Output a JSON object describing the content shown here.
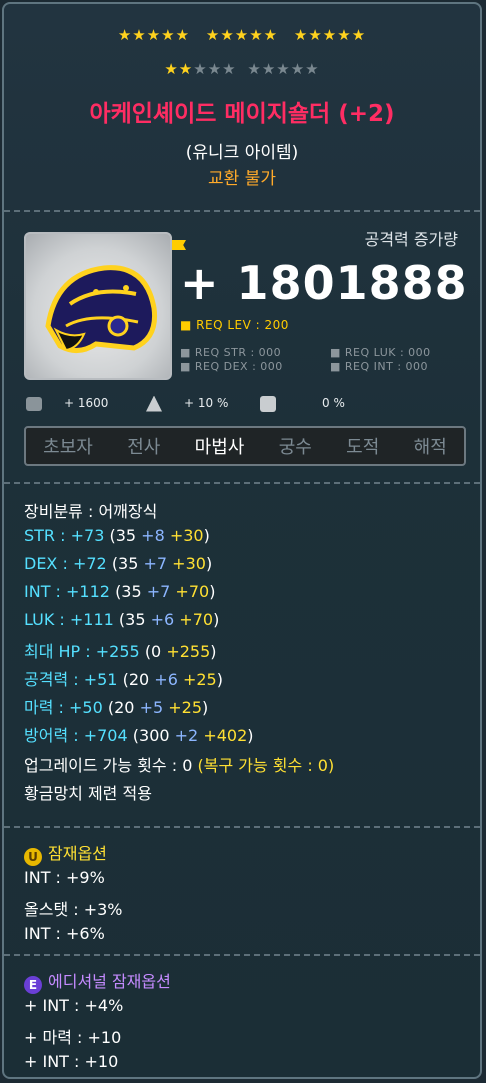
{
  "stars": {
    "row1": [
      "★★★★★",
      "★★★★★",
      "★★★★★"
    ],
    "row2_on": "★★",
    "row2_off": [
      "★★★",
      "★★★★★"
    ]
  },
  "item": {
    "name": "아케인셰이드 메이지숄더 (+2)",
    "grade": "(유니크 아이템)",
    "trade": "교환 불가"
  },
  "attack_increase": {
    "label": "공격력 증가량",
    "value": "+ 1801888"
  },
  "requirements": {
    "level": "■ REQ LEV : 200",
    "str": "■ REQ STR : 000",
    "luk": "■ REQ LUK : 000",
    "dex": "■ REQ DEX : 000",
    "int": "■ REQ INT : 000"
  },
  "mini_stats": {
    "boss": "+ 1600",
    "ignore": "+ 10 %",
    "def": "0 %"
  },
  "jobs": {
    "list": [
      "초보자",
      "전사",
      "마법사",
      "궁수",
      "도적",
      "해적"
    ],
    "active_index": 2
  },
  "stats": {
    "category": "장비분류 : 어깨장식",
    "str": {
      "label": "STR : +73",
      "base": "(35 ",
      "enh": "+8",
      "star": " +30",
      "close": ")"
    },
    "dex": {
      "label": "DEX : +72",
      "base": "(35 ",
      "enh": "+7",
      "star": " +30",
      "close": ")"
    },
    "int": {
      "label": "INT : +112",
      "base": "(35 ",
      "enh": "+7",
      "star": " +70",
      "close": ")"
    },
    "luk": {
      "label": "LUK : +111",
      "base": "(35 ",
      "enh": "+6",
      "star": " +70",
      "close": ")"
    },
    "hp": {
      "label": "최대 HP : +255",
      "base": "(0 ",
      "star": "+255",
      "close": ")"
    },
    "att": {
      "label": "공격력 : +51",
      "base": "(20 ",
      "enh": "+6",
      "star": " +25",
      "close": ")"
    },
    "matt": {
      "label": "마력 : +50",
      "base": "(20 ",
      "enh": "+5",
      "star": " +25",
      "close": ")"
    },
    "def": {
      "label": "방어력 : +704",
      "base": "(300 ",
      "enh": "+2",
      "star": " +402",
      "close": ")"
    },
    "upgrade": "업그레이드 가능 횟수 : 0",
    "restore": "(복구 가능 횟수 : 0)",
    "hammer": "황금망치 제련 적용"
  },
  "potential": {
    "badge": "U",
    "title": "잠재옵션",
    "lines": [
      "INT : +9%",
      "올스탯 : +3%",
      "INT : +6%"
    ]
  },
  "additional": {
    "badge": "E",
    "title": "에디셔널 잠재옵션",
    "lines": [
      "+ INT : +4%",
      "+ 마력 : +10",
      "+ INT : +10"
    ]
  },
  "colors": {
    "name": "#ff2d63",
    "enhance": "#8cb6ff",
    "starforce": "#ffe033",
    "potential_badge": "#e8b800",
    "additional_badge": "#6a3fd6"
  }
}
